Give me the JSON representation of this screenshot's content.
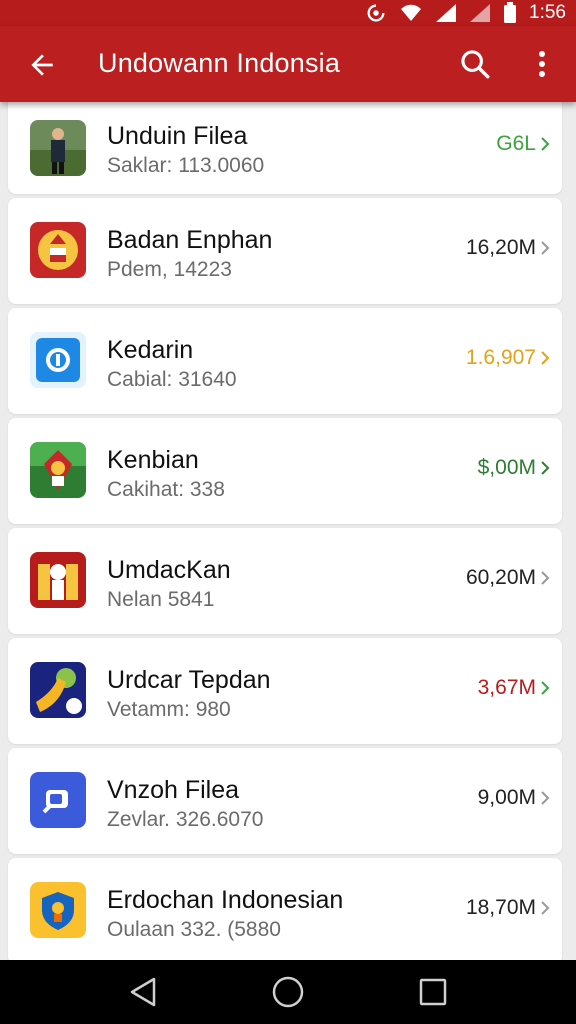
{
  "status_bar": {
    "time": "1:56"
  },
  "app_bar": {
    "title": "Undowann Indonsia"
  },
  "items": [
    {
      "name": "Unduin Filea",
      "sub": "Saklar: 113.0060",
      "value": "G6L",
      "value_color": "#3aa63a"
    },
    {
      "name": "Badan Enphan",
      "sub": "Pdem, 14223",
      "value": "16,20M",
      "value_color": "#222222"
    },
    {
      "name": "Kedarin",
      "sub": "Cabial: 31640",
      "value": "1.6,907",
      "value_color": "#e3a21a"
    },
    {
      "name": "Kenbian",
      "sub": "Cakihat: 338",
      "value": "$,00M",
      "value_color": "#2e7d32"
    },
    {
      "name": "UmdacKan",
      "sub": "Nelan 5841",
      "value": "60,20M",
      "value_color": "#222222"
    },
    {
      "name": "Urdcar Tepdan",
      "sub": "Vetamm: 980",
      "value": "3,67M",
      "value_color": "#b71c1c"
    },
    {
      "name": "Vnzoh Filea",
      "sub": "Zevlar. 326.6070",
      "value": "9,00M",
      "value_color": "#222222"
    },
    {
      "name": "Erdochan Indonesian",
      "sub": "Oulaan 332. (5880",
      "value": "18,70M",
      "value_color": "#222222"
    }
  ],
  "colors": {
    "primary": "#bb1f1f",
    "status": "#b71c1c"
  },
  "icons": [
    "back-arrow-icon",
    "search-icon",
    "more-vert-icon",
    "nav-back-icon",
    "nav-home-icon",
    "nav-recents-icon"
  ]
}
